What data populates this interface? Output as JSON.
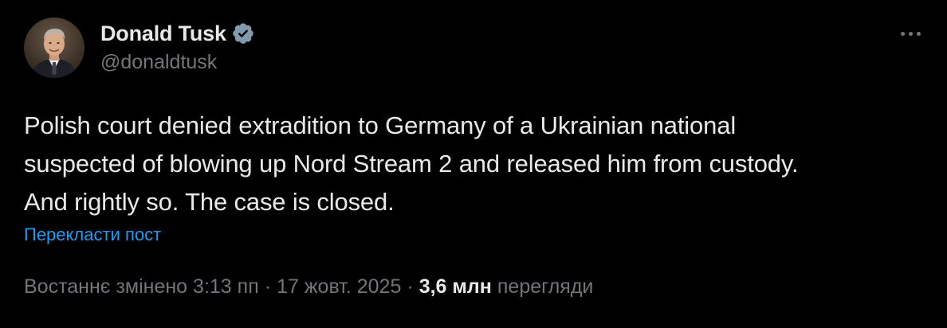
{
  "author": {
    "display_name": "Donald Tusk",
    "handle": "@donaldtusk",
    "verified": true
  },
  "icons": {
    "verified": "verified-badge-icon",
    "more": "more-options-icon"
  },
  "tweet": {
    "text_lines": [
      "Polish court denied extradition to Germany of a Ukrainian national",
      "suspected of blowing up Nord Stream 2 and released him from custody.",
      "And rightly so. The case is closed."
    ],
    "translate_label": "Перекласти пост"
  },
  "meta": {
    "edited_label": "Востаннє змінено",
    "time": "3:13 пп",
    "date": "17 жовт. 2025",
    "separator": "·",
    "views_count": "3,6 млн",
    "views_label": "перегляди"
  },
  "colors": {
    "background": "#000000",
    "text_primary": "#e7e9ea",
    "text_secondary": "#71767b",
    "link": "#1d9bf0",
    "verified_badge": "#829aab"
  }
}
